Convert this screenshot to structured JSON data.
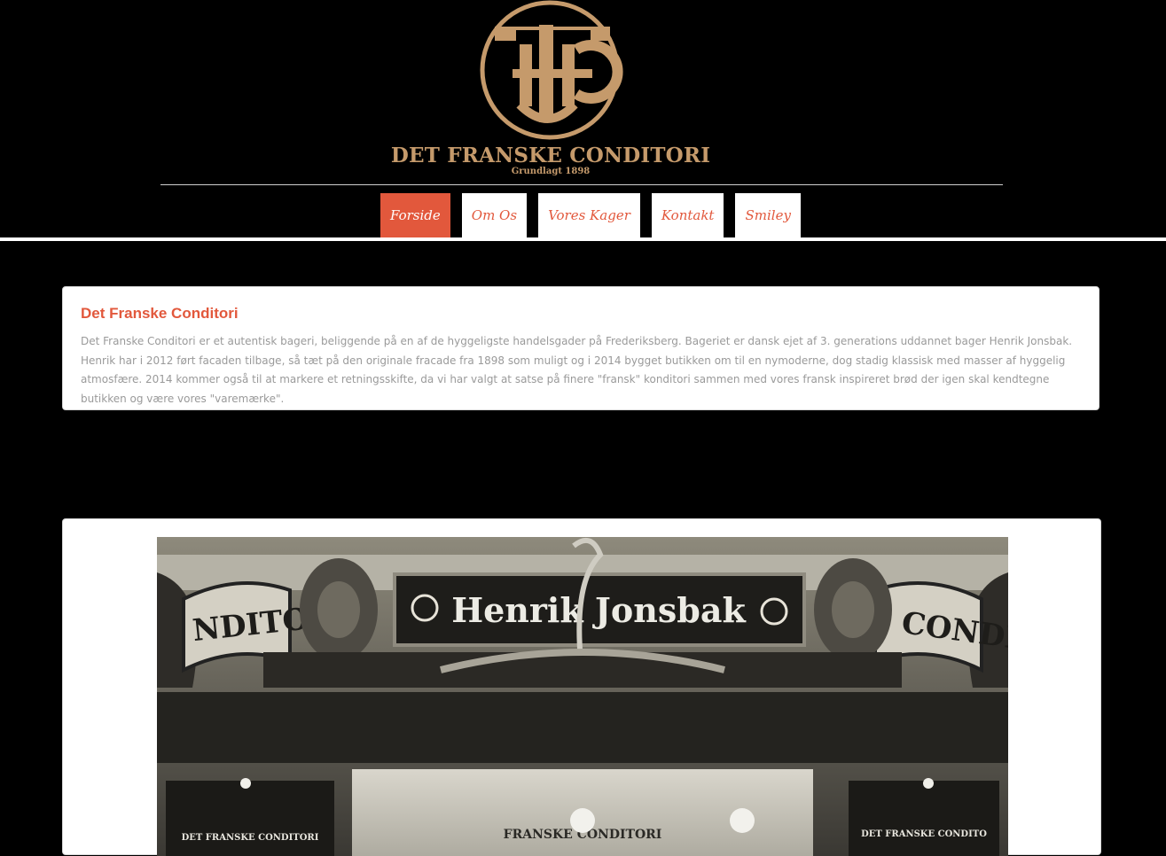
{
  "brand": {
    "name": "DET FRANSKE CONDITORI",
    "tagline": "Grundlagt 1898"
  },
  "nav": {
    "items": [
      {
        "label": "Forside",
        "active": true
      },
      {
        "label": "Om Os",
        "active": false
      },
      {
        "label": "Vores Kager",
        "active": false
      },
      {
        "label": "Kontakt",
        "active": false
      },
      {
        "label": "Smiley",
        "active": false
      }
    ]
  },
  "intro": {
    "title": "Det Franske Conditori",
    "body": "Det Franske Conditori er et autentisk bageri, beliggende på en af de hyggeligste handelsgader på Frederiksberg. Bageriet er dansk ejet af 3. generations uddannet bager Henrik Jonsbak. Henrik har i 2012 ført facaden tilbage, så tæt på den originale fracade fra 1898 som muligt og i 2014 bygget butikken om til en nymoderne, dog stadig klassisk med masser af hyggelig atmosfære. 2014 kommer også til at markere et retningsskifte, da vi har valgt at satse på finere \"fransk\" konditori sammen med vores fransk inspireret brød der igen skal kendtegne butikken og være vores \"varemærke\"."
  },
  "photo": {
    "sign_text": "Henrik Jonsbak",
    "side_left_text": "NDITORI",
    "side_right_text": "CONDI",
    "window_text_left": "DET FRANSKE CONDITORI",
    "window_text_center": "FRANSKE CONDITORI",
    "window_text_right": "DET FRANSKE CONDITO"
  },
  "colors": {
    "accent": "#e2583c",
    "gold": "#c59a6b",
    "background": "#000000",
    "panel": "#ffffff"
  }
}
